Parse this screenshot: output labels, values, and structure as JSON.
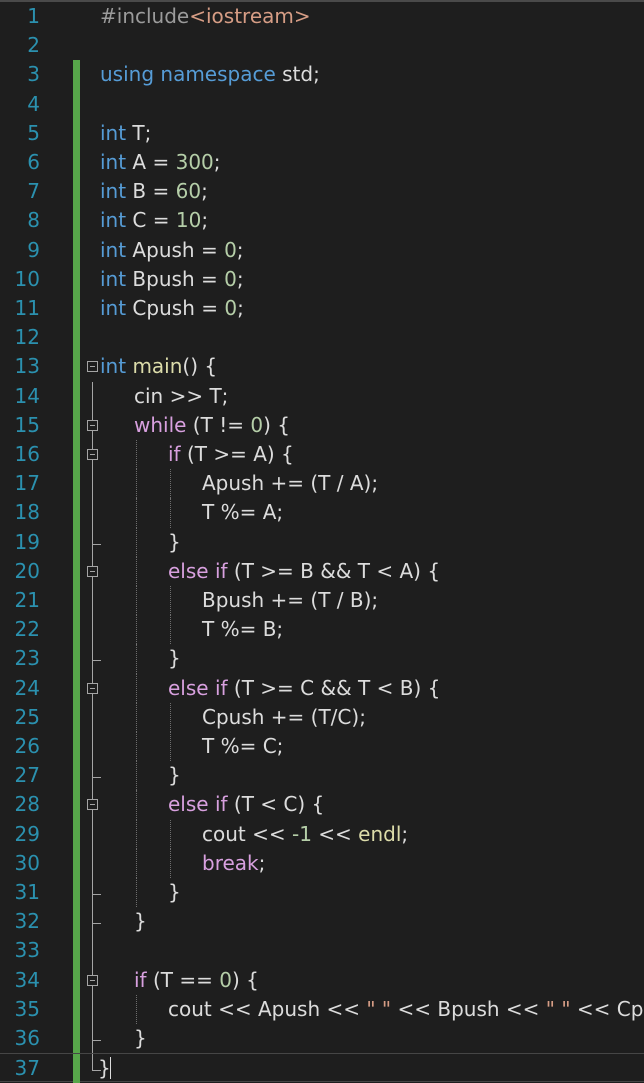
{
  "editor": {
    "language": "C++",
    "colors": {
      "background": "#1e1e1e",
      "line_number": "#2b91af",
      "keyword": "#569cd6",
      "control_keyword": "#d8a0df",
      "string": "#d69d85",
      "number": "#b5cea8",
      "preprocessor": "#9b9b9b",
      "plain": "#dcdcdc",
      "change_bar": "#57a64a"
    },
    "lines": [
      {
        "n": "1",
        "tokens": [
          [
            "pp",
            "#include"
          ],
          [
            "str",
            "<iostream>"
          ]
        ]
      },
      {
        "n": "2",
        "tokens": []
      },
      {
        "n": "3",
        "tokens": [
          [
            "kw",
            "using"
          ],
          [
            "pl",
            " "
          ],
          [
            "kw",
            "namespace"
          ],
          [
            "pl",
            " std;"
          ]
        ]
      },
      {
        "n": "4",
        "tokens": []
      },
      {
        "n": "5",
        "tokens": [
          [
            "kw",
            "int"
          ],
          [
            "pl",
            " T;"
          ]
        ]
      },
      {
        "n": "6",
        "tokens": [
          [
            "kw",
            "int"
          ],
          [
            "pl",
            " A = "
          ],
          [
            "num",
            "300"
          ],
          [
            "pl",
            ";"
          ]
        ]
      },
      {
        "n": "7",
        "tokens": [
          [
            "kw",
            "int"
          ],
          [
            "pl",
            " B = "
          ],
          [
            "num",
            "60"
          ],
          [
            "pl",
            ";"
          ]
        ]
      },
      {
        "n": "8",
        "tokens": [
          [
            "kw",
            "int"
          ],
          [
            "pl",
            " C = "
          ],
          [
            "num",
            "10"
          ],
          [
            "pl",
            ";"
          ]
        ]
      },
      {
        "n": "9",
        "tokens": [
          [
            "kw",
            "int"
          ],
          [
            "pl",
            " Apush = "
          ],
          [
            "num",
            "0"
          ],
          [
            "pl",
            ";"
          ]
        ]
      },
      {
        "n": "10",
        "tokens": [
          [
            "kw",
            "int"
          ],
          [
            "pl",
            " Bpush = "
          ],
          [
            "num",
            "0"
          ],
          [
            "pl",
            ";"
          ]
        ]
      },
      {
        "n": "11",
        "tokens": [
          [
            "kw",
            "int"
          ],
          [
            "pl",
            " Cpush = "
          ],
          [
            "num",
            "0"
          ],
          [
            "pl",
            ";"
          ]
        ]
      },
      {
        "n": "12",
        "tokens": []
      },
      {
        "n": "13",
        "tokens": [
          [
            "kw",
            "int"
          ],
          [
            "pl",
            " "
          ],
          [
            "fn",
            "main"
          ],
          [
            "pl",
            "() {"
          ]
        ]
      },
      {
        "n": "14",
        "tokens": [
          [
            "pl",
            "cin >> T;"
          ]
        ]
      },
      {
        "n": "15",
        "tokens": [
          [
            "ctl",
            "while"
          ],
          [
            "pl",
            " (T != "
          ],
          [
            "num",
            "0"
          ],
          [
            "pl",
            ") {"
          ]
        ]
      },
      {
        "n": "16",
        "tokens": [
          [
            "ctl",
            "if"
          ],
          [
            "pl",
            " (T >= A) {"
          ]
        ]
      },
      {
        "n": "17",
        "tokens": [
          [
            "pl",
            "Apush += (T / A);"
          ]
        ]
      },
      {
        "n": "18",
        "tokens": [
          [
            "pl",
            "T %= A;"
          ]
        ]
      },
      {
        "n": "19",
        "tokens": [
          [
            "pl",
            "}"
          ]
        ]
      },
      {
        "n": "20",
        "tokens": [
          [
            "ctl",
            "else"
          ],
          [
            "pl",
            " "
          ],
          [
            "ctl",
            "if"
          ],
          [
            "pl",
            " (T >= B && T < A) {"
          ]
        ]
      },
      {
        "n": "21",
        "tokens": [
          [
            "pl",
            "Bpush += (T / B);"
          ]
        ]
      },
      {
        "n": "22",
        "tokens": [
          [
            "pl",
            "T %= B;"
          ]
        ]
      },
      {
        "n": "23",
        "tokens": [
          [
            "pl",
            "}"
          ]
        ]
      },
      {
        "n": "24",
        "tokens": [
          [
            "ctl",
            "else"
          ],
          [
            "pl",
            " "
          ],
          [
            "ctl",
            "if"
          ],
          [
            "pl",
            " (T >= C && T < B) {"
          ]
        ]
      },
      {
        "n": "25",
        "tokens": [
          [
            "pl",
            "Cpush += (T/C);"
          ]
        ]
      },
      {
        "n": "26",
        "tokens": [
          [
            "pl",
            "T %= C;"
          ]
        ]
      },
      {
        "n": "27",
        "tokens": [
          [
            "pl",
            "}"
          ]
        ]
      },
      {
        "n": "28",
        "tokens": [
          [
            "ctl",
            "else"
          ],
          [
            "pl",
            " "
          ],
          [
            "ctl",
            "if"
          ],
          [
            "pl",
            " (T < C) {"
          ]
        ]
      },
      {
        "n": "29",
        "tokens": [
          [
            "pl",
            "cout << "
          ],
          [
            "num",
            "-1"
          ],
          [
            "pl",
            " << "
          ],
          [
            "fn",
            "endl"
          ],
          [
            "pl",
            ";"
          ]
        ]
      },
      {
        "n": "30",
        "tokens": [
          [
            "ctl",
            "break"
          ],
          [
            "pl",
            ";"
          ]
        ]
      },
      {
        "n": "31",
        "tokens": [
          [
            "pl",
            "}"
          ]
        ]
      },
      {
        "n": "32",
        "tokens": [
          [
            "pl",
            "}"
          ]
        ]
      },
      {
        "n": "33",
        "tokens": []
      },
      {
        "n": "34",
        "tokens": [
          [
            "ctl",
            "if"
          ],
          [
            "pl",
            " (T == "
          ],
          [
            "num",
            "0"
          ],
          [
            "pl",
            ") {"
          ]
        ]
      },
      {
        "n": "35",
        "tokens": [
          [
            "pl",
            "cout << Apush << "
          ],
          [
            "str",
            "\" \""
          ],
          [
            "pl",
            " << Bpush << "
          ],
          [
            "str",
            "\" \""
          ],
          [
            "pl",
            " << Cpush;"
          ]
        ]
      },
      {
        "n": "36",
        "tokens": [
          [
            "pl",
            "}"
          ]
        ]
      },
      {
        "n": "37",
        "tokens": [
          [
            "pl",
            "}"
          ]
        ]
      }
    ]
  }
}
